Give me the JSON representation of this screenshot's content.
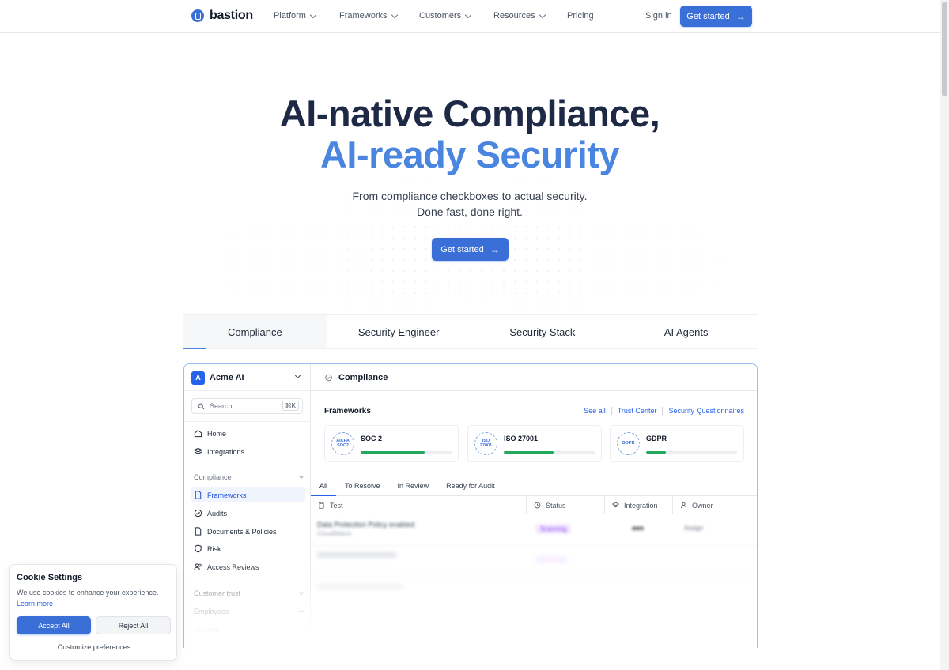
{
  "nav": {
    "brand": "bastion",
    "items": [
      "Platform",
      "Frameworks",
      "Customers",
      "Resources"
    ],
    "pricing": "Pricing",
    "sign_in": "Sign in",
    "cta": "Get started"
  },
  "hero": {
    "title_line1": "AI-native Compliance,",
    "title_line2": "AI-ready Security",
    "subtitle_line1": "From compliance checkboxes to actual security.",
    "subtitle_line2": "Done fast, done right.",
    "cta": "Get started"
  },
  "tabs": [
    "Compliance",
    "Security Engineer",
    "Security Stack",
    "AI Agents"
  ],
  "app": {
    "org_initial": "A",
    "org_name": "Acme AI",
    "search_placeholder": "Search",
    "search_shortcut": "⌘K",
    "nav_top": [
      "Home",
      "Integrations"
    ],
    "group_compliance": "Compliance",
    "compliance_items": [
      "Frameworks",
      "Audits",
      "Documents & Policies",
      "Risk",
      "Access Reviews"
    ],
    "group_customer_trust": "Customer trust",
    "group_employees": "Employees",
    "group_devices": "Devices",
    "page_title": "Compliance",
    "frameworks_title": "Frameworks",
    "links": [
      "See all",
      "Trust Center",
      "Security Questionnaires"
    ],
    "frameworks": [
      {
        "name": "SOC 2",
        "badge_line1": "AICPA",
        "badge_line2": "SOC2",
        "progress": 0.7
      },
      {
        "name": "ISO 27001",
        "badge_line1": "ISO",
        "badge_line2": "27001",
        "progress": 0.55
      },
      {
        "name": "GDPR",
        "badge_line1": "GDPR",
        "badge_line2": "",
        "progress": 0.22
      }
    ],
    "subtabs": [
      "All",
      "To Resolve",
      "In Review",
      "Ready for Audit"
    ],
    "columns": [
      "Test",
      "Status",
      "Integration",
      "Owner"
    ],
    "rows": [
      {
        "test": "Data Protection Policy enabled",
        "source": "CloudWatch",
        "status": "Scanning",
        "integration": "aws",
        "owner": "Assign"
      }
    ]
  },
  "cookie": {
    "title": "Cookie Settings",
    "text": "We use cookies to enhance your experience.",
    "learn_more": "Learn more",
    "accept": "Accept All",
    "reject": "Reject All",
    "customize": "Customize preferences"
  },
  "colors": {
    "accent": "#3b6fd8",
    "title_dark": "#1e2a45",
    "title_blue": "#4a86e0",
    "progress_green": "#22a75c"
  }
}
